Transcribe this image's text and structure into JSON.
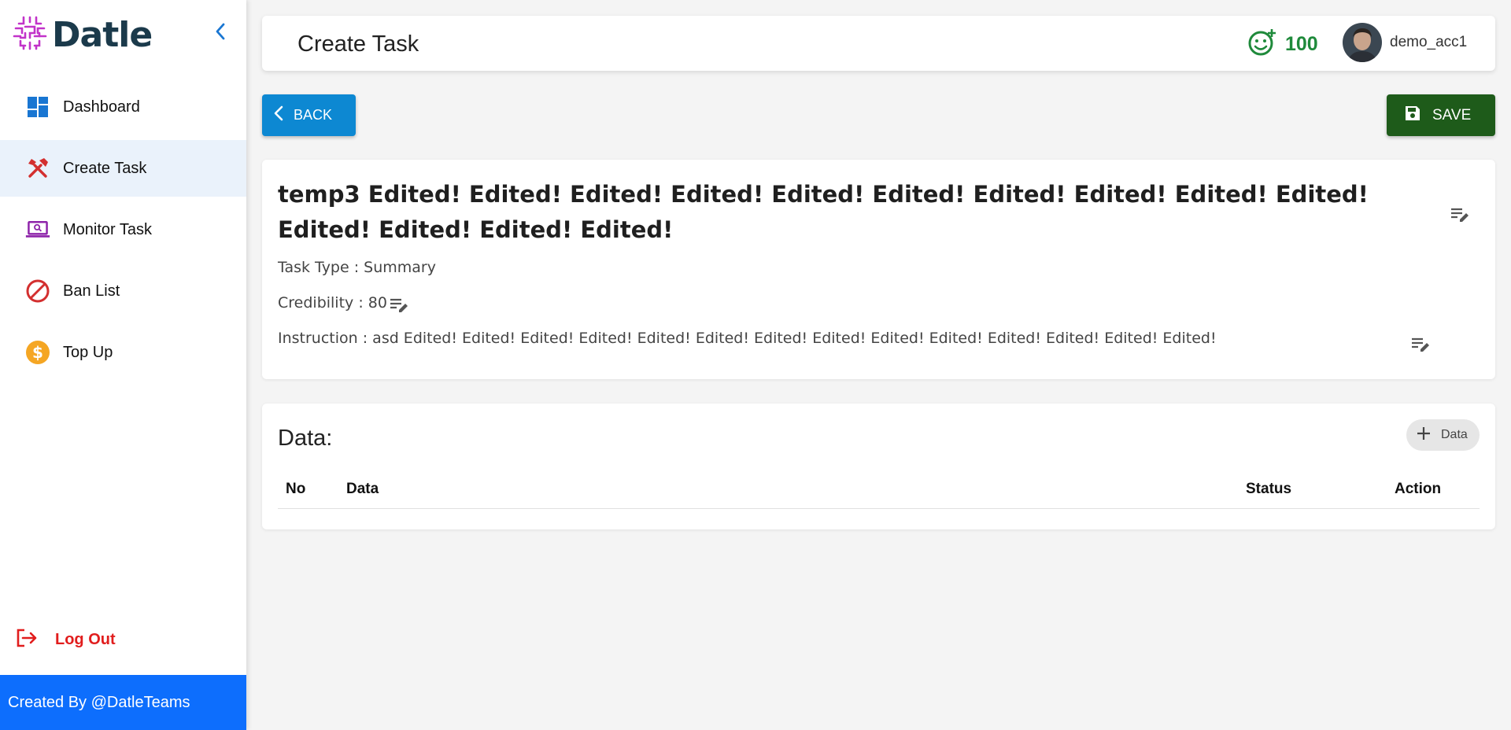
{
  "brand": {
    "name": "Datle",
    "logo_color": "#c233c9"
  },
  "sidebar": {
    "items": [
      {
        "label": "Dashboard",
        "icon": "dashboard-icon"
      },
      {
        "label": "Create Task",
        "icon": "tools-icon",
        "active": true
      },
      {
        "label": "Monitor Task",
        "icon": "monitor-icon"
      },
      {
        "label": "Ban List",
        "icon": "ban-icon"
      },
      {
        "label": "Top Up",
        "icon": "dollar-icon"
      }
    ],
    "logout_label": "Log Out",
    "footer": "Created By @DatleTeams"
  },
  "header": {
    "title": "Create Task",
    "credits": "100",
    "username": "demo_acc1"
  },
  "toolbar": {
    "back_label": "BACK",
    "save_label": "SAVE"
  },
  "task": {
    "title": "temp3 Edited! Edited! Edited! Edited! Edited! Edited! Edited! Edited! Edited! Edited! Edited! Edited! Edited! Edited!",
    "type_line": "Task Type : Summary",
    "credibility_line": "Credibility : 80",
    "instruction_line": "Instruction :  asd Edited! Edited! Edited! Edited! Edited! Edited! Edited! Edited! Edited! Edited! Edited! Edited! Edited! Edited!"
  },
  "data_section": {
    "heading": "Data:",
    "add_label": "Data",
    "columns": [
      "No",
      "Data",
      "Status",
      "Action"
    ],
    "rows": []
  },
  "colors": {
    "primary": "#0d88d2",
    "save": "#1e5b1a",
    "footer": "#0d6efd",
    "logout": "#e11d1d",
    "credits": "#1f8a3b"
  }
}
